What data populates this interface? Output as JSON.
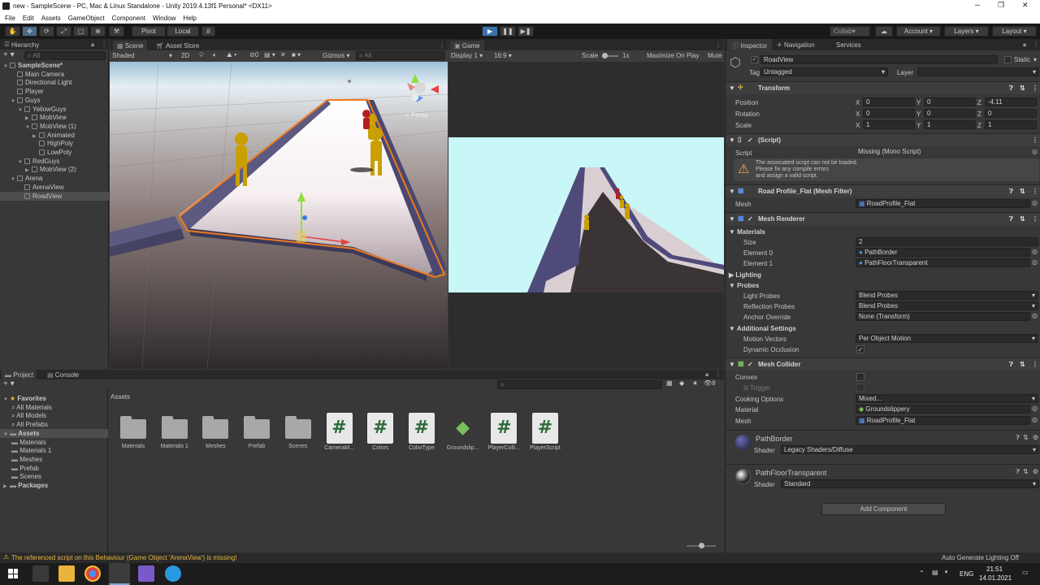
{
  "window": {
    "title": "new - SampleScene - PC, Mac & Linux Standalone - Unity 2019.4.13f1 Personal* <DX11>"
  },
  "menu": [
    "File",
    "Edit",
    "Assets",
    "GameObject",
    "Component",
    "Window",
    "Help"
  ],
  "toolbar": {
    "pivot": "Pivot",
    "local": "Local",
    "collab": "Collab",
    "account": "Account",
    "layers": "Layers",
    "layout": "Layout"
  },
  "hierarchy": {
    "tab": "Hierarchy",
    "search_placeholder": "All",
    "items": [
      {
        "label": "SampleScene*",
        "depth": 0,
        "arrow": "▼",
        "scene": true
      },
      {
        "label": "Main Camera",
        "depth": 1,
        "arrow": ""
      },
      {
        "label": "Directional Light",
        "depth": 1,
        "arrow": ""
      },
      {
        "label": "Player",
        "depth": 1,
        "arrow": ""
      },
      {
        "label": "Guys",
        "depth": 1,
        "arrow": "▼"
      },
      {
        "label": "YellowGuys",
        "depth": 2,
        "arrow": "▼"
      },
      {
        "label": "MobView",
        "depth": 3,
        "arrow": "▶"
      },
      {
        "label": "MobView (1)",
        "depth": 3,
        "arrow": "▼"
      },
      {
        "label": "Animated",
        "depth": 4,
        "arrow": "▶"
      },
      {
        "label": "HighPoly",
        "depth": 4,
        "arrow": ""
      },
      {
        "label": "LowPoly",
        "depth": 4,
        "arrow": ""
      },
      {
        "label": "RedGuys",
        "depth": 2,
        "arrow": "▼"
      },
      {
        "label": "MobView (2)",
        "depth": 3,
        "arrow": "▶"
      },
      {
        "label": "Arena",
        "depth": 1,
        "arrow": "▼"
      },
      {
        "label": "ArenaView",
        "depth": 2,
        "arrow": ""
      },
      {
        "label": "RoadView",
        "depth": 2,
        "arrow": "",
        "selected": true
      }
    ]
  },
  "scene": {
    "tab": "Scene",
    "tab2": "Asset Store",
    "shading": "Shaded",
    "mode2d": "2D",
    "gizmos": "Gizmos",
    "search": "All",
    "persp": "< Persp",
    "fx_count": "0"
  },
  "game": {
    "tab": "Game",
    "display": "Display 1",
    "aspect": "16:9",
    "scale_label": "Scale",
    "scale_value": "1x",
    "maximize": "Maximize On Play",
    "mute": "Mute"
  },
  "inspector": {
    "tabs": [
      "Inspector",
      "Navigation",
      "Services"
    ],
    "object_name": "RoadView",
    "static": "Static",
    "tag_label": "Tag",
    "tag": "Untagged",
    "layer_label": "Layer",
    "layer": "",
    "transform": {
      "title": "Transform",
      "position": {
        "label": "Position",
        "x": "0",
        "y": "0",
        "z": "-4.11"
      },
      "rotation": {
        "label": "Rotation",
        "x": "0",
        "y": "0",
        "z": "0"
      },
      "scale": {
        "label": "Scale",
        "x": "1",
        "y": "1",
        "z": "1"
      }
    },
    "script": {
      "title": "(Script)",
      "label": "Script",
      "value": "Missing (Mono Script)",
      "warning": [
        "The associated script can not be loaded.",
        "Please fix any compile errors",
        "and assign a valid script."
      ]
    },
    "mesh_filter": {
      "title": "Road Profile_Flat (Mesh Filter)",
      "label": "Mesh",
      "value": "RoadProfile_Flat"
    },
    "mesh_renderer": {
      "title": "Mesh Renderer",
      "materials": "Materials",
      "size_label": "Size",
      "size": "2",
      "el0_label": "Element 0",
      "el0": "PathBorder",
      "el1_label": "Element 1",
      "el1": "PathFloorTransparent",
      "lighting": "Lighting",
      "probes": "Probes",
      "light_probes_label": "Light Probes",
      "light_probes": "Blend Probes",
      "reflection_label": "Reflection Probes",
      "reflection": "Blend Probes",
      "anchor_label": "Anchor Override",
      "anchor": "None (Transform)",
      "additional": "Additional Settings",
      "motion_label": "Motion Vectors",
      "motion": "Per Object Motion",
      "occlusion_label": "Dynamic Occlusion"
    },
    "mesh_collider": {
      "title": "Mesh Collider",
      "convex": "Convex",
      "trigger": "Is Trigger",
      "cooking_label": "Cooking Options",
      "cooking": "Mixed...",
      "material_label": "Material",
      "material": "Groundslippery",
      "mesh_label": "Mesh",
      "mesh": "RoadProfile_Flat"
    },
    "materials": [
      {
        "name": "PathBorder",
        "shader_label": "Shader",
        "shader": "Legacy Shaders/Diffuse"
      },
      {
        "name": "PathFloorTransparent",
        "shader_label": "Shader",
        "shader": "Standard"
      }
    ],
    "add_component": "Add Component"
  },
  "project": {
    "tabs": [
      "Project",
      "Console"
    ],
    "badge": "8",
    "tree": [
      {
        "label": "Favorites",
        "depth": 0,
        "bold": true,
        "arrow": "▼",
        "star": true
      },
      {
        "label": "All Materials",
        "depth": 1
      },
      {
        "label": "All Models",
        "depth": 1
      },
      {
        "label": "All Prefabs",
        "depth": 1
      },
      {
        "label": "Assets",
        "depth": 0,
        "bold": true,
        "arrow": "▼",
        "selected": true
      },
      {
        "label": "Materials",
        "depth": 1
      },
      {
        "label": "Materials 1",
        "depth": 1
      },
      {
        "label": "Meshes",
        "depth": 1
      },
      {
        "label": "Prefab",
        "depth": 1
      },
      {
        "label": "Scenes",
        "depth": 1
      },
      {
        "label": "Packages",
        "depth": 0,
        "bold": true,
        "arrow": "▶"
      }
    ],
    "breadcrumb": "Assets",
    "assets": [
      {
        "label": "Materials",
        "type": "folder"
      },
      {
        "label": "Materials 1",
        "type": "folder"
      },
      {
        "label": "Meshes",
        "type": "folder"
      },
      {
        "label": "Prefab",
        "type": "folder"
      },
      {
        "label": "Scenes",
        "type": "folder"
      },
      {
        "label": "CameraM...",
        "type": "script"
      },
      {
        "label": "Colors",
        "type": "script"
      },
      {
        "label": "ColorType",
        "type": "script"
      },
      {
        "label": "Groundslip...",
        "type": "physmat"
      },
      {
        "label": "PlayerColli...",
        "type": "script"
      },
      {
        "label": "PlayerScript",
        "type": "script"
      }
    ]
  },
  "status": {
    "message": "The referenced script on this Behaviour (Game Object 'ArenaView') is missing!",
    "right": "Auto Generate Lighting Off"
  },
  "taskbar": {
    "lang": "ENG",
    "time": "21:51",
    "date": "14.01.2021"
  },
  "colors": {
    "accent": "#3a72b0",
    "selection": "#4d4d4d",
    "warning": "#e8b43c",
    "outline": "#f07a1e",
    "sky": "#c9f6f6"
  }
}
